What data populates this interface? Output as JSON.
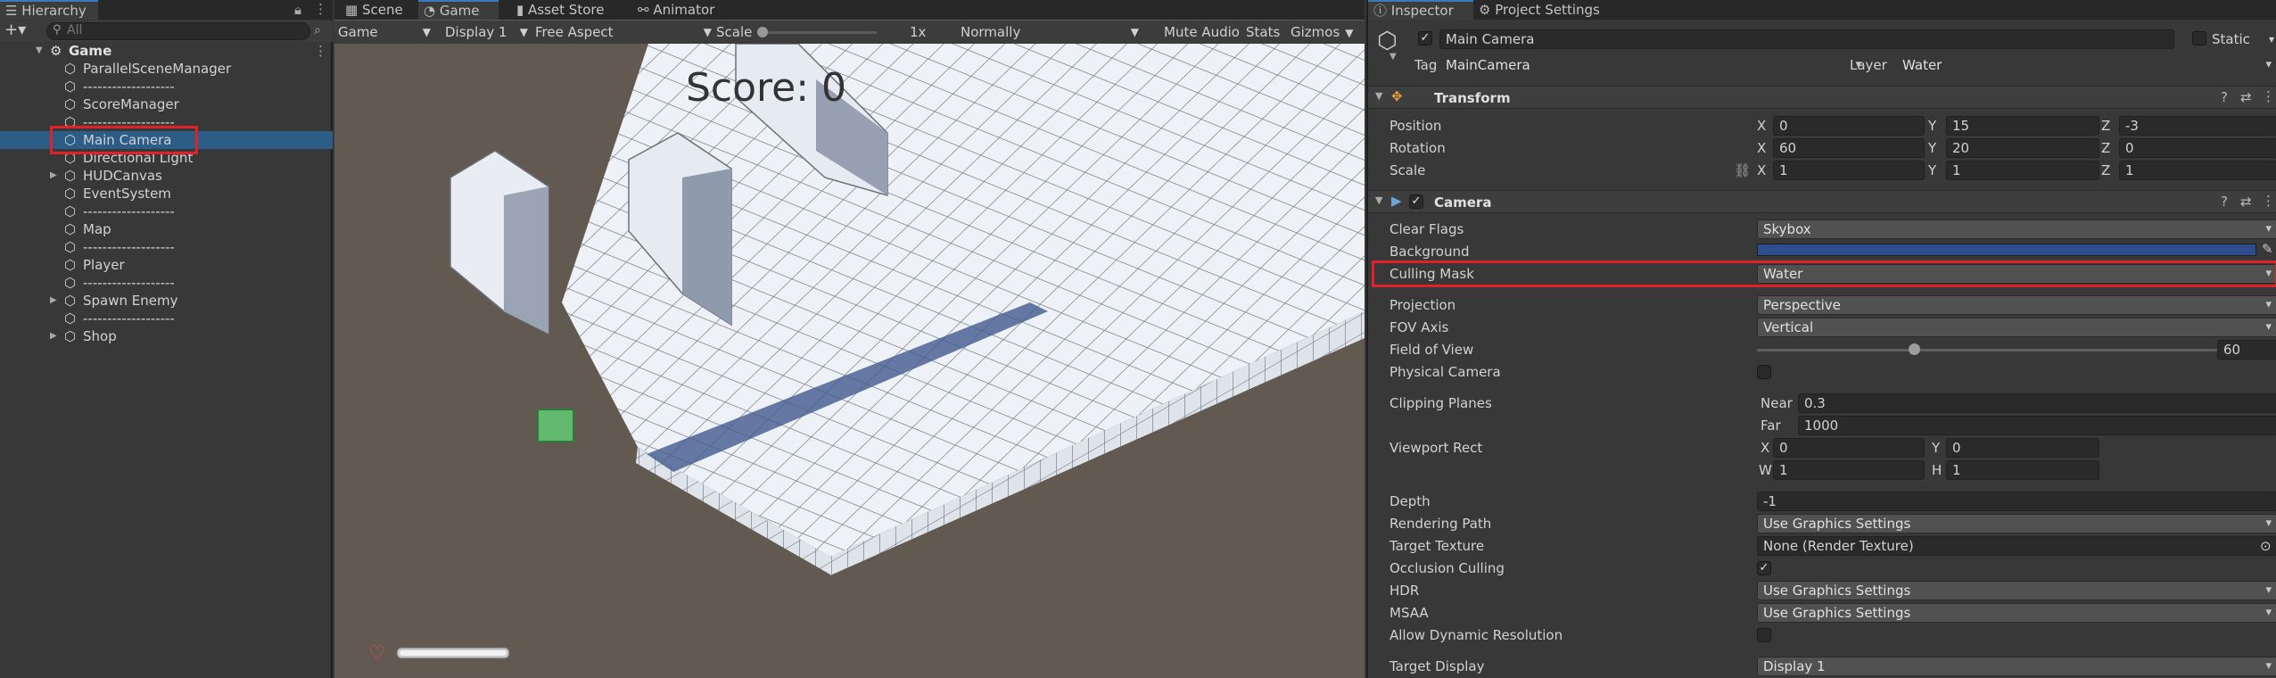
{
  "hierarchy": {
    "tab": "Hierarchy",
    "search_placeholder": "All",
    "scene": "Game",
    "items": [
      {
        "label": "ParallelSceneManager",
        "indent": 1
      },
      {
        "label": "-------------------",
        "indent": 1
      },
      {
        "label": "ScoreManager",
        "indent": 1
      },
      {
        "label": "-------------------",
        "indent": 1
      },
      {
        "label": "Main Camera",
        "indent": 1,
        "selected": true
      },
      {
        "label": "Directional Light",
        "indent": 1
      },
      {
        "label": "HUDCanvas",
        "indent": 1,
        "expandable": true
      },
      {
        "label": "EventSystem",
        "indent": 1
      },
      {
        "label": "-------------------",
        "indent": 1
      },
      {
        "label": "Map",
        "indent": 1
      },
      {
        "label": "-------------------",
        "indent": 1
      },
      {
        "label": "Player",
        "indent": 1
      },
      {
        "label": "-------------------",
        "indent": 1
      },
      {
        "label": "Spawn Enemy",
        "indent": 1,
        "expandable": true
      },
      {
        "label": "-------------------",
        "indent": 1
      },
      {
        "label": "Shop",
        "indent": 1,
        "expandable": true
      }
    ]
  },
  "center_tabs": {
    "scene": "Scene",
    "game": "Game",
    "asset_store": "Asset Store",
    "animator": "Animator"
  },
  "game_toolbar": {
    "mode": "Game",
    "display": "Display 1",
    "aspect": "Free Aspect",
    "scale_label": "Scale",
    "scale_value": "1x",
    "play_focus": "Normally",
    "mute": "Mute Audio",
    "stats": "Stats",
    "gizmos": "Gizmos"
  },
  "game_view": {
    "score_text": "Score: 0",
    "health_fraction": 1.0
  },
  "inspector": {
    "tab": "Inspector",
    "tab2": "Project Settings",
    "object_name": "Main Camera",
    "static_label": "Static",
    "tag_label": "Tag",
    "tag_value": "MainCamera",
    "layer_label": "Layer",
    "layer_value": "Water",
    "transform": {
      "title": "Transform",
      "position_label": "Position",
      "rotation_label": "Rotation",
      "scale_label": "Scale",
      "position": {
        "x": "0",
        "y": "15",
        "z": "-3"
      },
      "rotation": {
        "x": "60",
        "y": "20",
        "z": "0"
      },
      "scale": {
        "x": "1",
        "y": "1",
        "z": "1"
      }
    },
    "camera": {
      "title": "Camera",
      "clear_flags_label": "Clear Flags",
      "clear_flags": "Skybox",
      "background_label": "Background",
      "background_color": "#2e4d8c",
      "culling_mask_label": "Culling Mask",
      "culling_mask": "Water",
      "projection_label": "Projection",
      "projection": "Perspective",
      "fov_axis_label": "FOV Axis",
      "fov_axis": "Vertical",
      "fov_label": "Field of View",
      "fov_value": "60",
      "physical_label": "Physical Camera",
      "clipping_label": "Clipping Planes",
      "near_label": "Near",
      "near": "0.3",
      "far_label": "Far",
      "far": "1000",
      "viewport_label": "Viewport Rect",
      "vp_x": "0",
      "vp_y": "0",
      "vp_w": "1",
      "vp_h": "1",
      "depth_label": "Depth",
      "depth": "-1",
      "rendering_path_label": "Rendering Path",
      "rendering_path": "Use Graphics Settings",
      "target_texture_label": "Target Texture",
      "target_texture": "None (Render Texture)",
      "occlusion_label": "Occlusion Culling",
      "hdr_label": "HDR",
      "hdr": "Use Graphics Settings",
      "msaa_label": "MSAA",
      "msaa": "Use Graphics Settings",
      "dynamic_res_label": "Allow Dynamic Resolution",
      "target_display_label": "Target Display",
      "target_display": "Display 1"
    }
  },
  "axis": {
    "x": "X",
    "y": "Y",
    "z": "Z",
    "w": "W",
    "h": "H"
  }
}
